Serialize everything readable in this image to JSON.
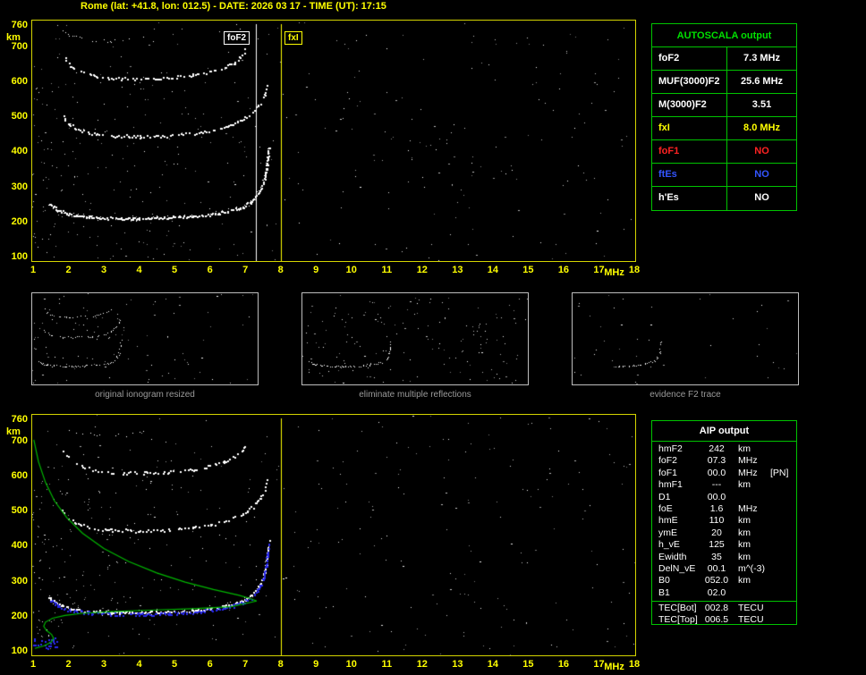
{
  "header": {
    "title": "Rome (lat: +41.8, lon: 012.5) - DATE: 2026 03 17 - TIME (UT): 17:15"
  },
  "autoscala_table": {
    "title": "AUTOSCALA output",
    "rows": [
      {
        "param": "foF2",
        "value": "7.3 MHz",
        "color": "#ffffff"
      },
      {
        "param": "MUF(3000)F2",
        "value": "25.6 MHz",
        "color": "#ffffff"
      },
      {
        "param": "M(3000)F2",
        "value": "3.51",
        "color": "#ffffff"
      },
      {
        "param": "fxI",
        "value": "8.0 MHz",
        "color": "#ffff00"
      },
      {
        "param": "foF1",
        "value": "NO",
        "color": "#ff2222"
      },
      {
        "param": "ftEs",
        "value": "NO",
        "color": "#3355ff"
      },
      {
        "param": "h'Es",
        "value": "NO",
        "color": "#ffffff"
      }
    ]
  },
  "aip_table": {
    "title": "AIP output",
    "rows": [
      {
        "param": "hmF2",
        "value": "242",
        "unit": "km",
        "note": ""
      },
      {
        "param": "foF2",
        "value": "07.3",
        "unit": "MHz",
        "note": ""
      },
      {
        "param": "foF1",
        "value": "00.0",
        "unit": "MHz",
        "note": "[PN]"
      },
      {
        "param": "hmF1",
        "value": "---",
        "unit": "km",
        "note": ""
      },
      {
        "param": "D1",
        "value": "00.0",
        "unit": "",
        "note": ""
      },
      {
        "param": "foE",
        "value": "1.6",
        "unit": "MHz",
        "note": ""
      },
      {
        "param": "hmE",
        "value": "110",
        "unit": "km",
        "note": ""
      },
      {
        "param": "ymE",
        "value": "20",
        "unit": "km",
        "note": ""
      },
      {
        "param": "h_vE",
        "value": "125",
        "unit": "km",
        "note": ""
      },
      {
        "param": "Ewidth",
        "value": "35",
        "unit": "km",
        "note": ""
      },
      {
        "param": "DelN_vE",
        "value": "00.1",
        "unit": "m^(-3)",
        "note": ""
      },
      {
        "param": "B0",
        "value": "052.0",
        "unit": "km",
        "note": ""
      },
      {
        "param": "B1",
        "value": "02.0",
        "unit": "",
        "note": ""
      }
    ],
    "tec_rows": [
      {
        "param": "TEC[Bot]",
        "value": "002.8",
        "unit": "TECU"
      },
      {
        "param": "TEC[Top]",
        "value": "006.5",
        "unit": "TECU"
      }
    ]
  },
  "thumbnails": [
    {
      "caption": "original ionogram resized"
    },
    {
      "caption": "eliminate multiple reflections"
    },
    {
      "caption": "evidence F2 trace"
    }
  ],
  "chart_data": {
    "type": "scatter",
    "title": "Ionogram: virtual height (km) vs sounding frequency (MHz)",
    "x_axis": {
      "label": "MHz",
      "min": 1,
      "max": 18,
      "ticks": [
        1,
        2,
        3,
        4,
        5,
        6,
        7,
        8,
        9,
        10,
        11,
        12,
        13,
        14,
        15,
        16,
        17,
        18
      ]
    },
    "y_axis": {
      "label": "km",
      "min": 100,
      "max": 760,
      "ticks": [
        760,
        700,
        600,
        500,
        400,
        300,
        200,
        100
      ]
    },
    "markers": [
      {
        "name": "foF2",
        "freq_mhz": 7.3,
        "color": "#ffffff"
      },
      {
        "name": "fxI",
        "freq_mhz": 8.0,
        "color": "#ffff00"
      }
    ],
    "traces": {
      "echo1": [
        [
          1.45,
          252
        ],
        [
          1.7,
          233
        ],
        [
          2.0,
          222
        ],
        [
          2.5,
          215
        ],
        [
          3.2,
          211
        ],
        [
          4.0,
          210
        ],
        [
          4.8,
          212
        ],
        [
          5.5,
          216
        ],
        [
          6.0,
          221
        ],
        [
          6.5,
          230
        ],
        [
          6.9,
          242
        ],
        [
          7.15,
          257
        ],
        [
          7.35,
          280
        ],
        [
          7.5,
          310
        ],
        [
          7.58,
          348
        ],
        [
          7.63,
          385
        ],
        [
          7.66,
          412
        ]
      ],
      "echo2": [
        [
          1.8,
          505
        ],
        [
          2.0,
          478
        ],
        [
          2.3,
          461
        ],
        [
          2.7,
          451
        ],
        [
          3.2,
          446
        ],
        [
          4.0,
          443
        ],
        [
          4.8,
          446
        ],
        [
          5.5,
          452
        ],
        [
          6.0,
          460
        ],
        [
          6.5,
          472
        ],
        [
          6.9,
          490
        ],
        [
          7.2,
          512
        ],
        [
          7.4,
          538
        ],
        [
          7.55,
          565
        ],
        [
          7.62,
          588
        ]
      ],
      "echo3": [
        [
          1.85,
          672
        ],
        [
          2.05,
          645
        ],
        [
          2.35,
          626
        ],
        [
          2.8,
          614
        ],
        [
          3.5,
          608
        ],
        [
          4.2,
          608
        ],
        [
          4.9,
          612
        ],
        [
          5.5,
          618
        ],
        [
          6.0,
          628
        ],
        [
          6.4,
          640
        ],
        [
          6.7,
          655
        ],
        [
          6.9,
          674
        ],
        [
          7.0,
          692
        ]
      ],
      "echo4": [
        [
          1.75,
          750
        ],
        [
          2.0,
          734
        ],
        [
          2.3,
          723
        ],
        [
          2.7,
          716
        ],
        [
          3.2,
          714
        ],
        [
          3.7,
          717
        ],
        [
          4.1,
          723
        ]
      ],
      "f2_evidence": [
        [
          4.2,
          210
        ],
        [
          4.8,
          212
        ],
        [
          5.5,
          216
        ],
        [
          6.0,
          221
        ],
        [
          6.5,
          230
        ],
        [
          6.9,
          242
        ],
        [
          7.15,
          257
        ],
        [
          7.35,
          280
        ],
        [
          7.5,
          310
        ],
        [
          7.58,
          348
        ],
        [
          7.63,
          385
        ],
        [
          7.66,
          412
        ]
      ]
    },
    "profile_green": {
      "color": "#00b800",
      "topside": [
        [
          1.02,
          702
        ],
        [
          1.15,
          640
        ],
        [
          1.35,
          580
        ],
        [
          1.6,
          528
        ],
        [
          1.95,
          480
        ],
        [
          2.4,
          435
        ],
        [
          3.0,
          392
        ],
        [
          3.7,
          355
        ],
        [
          4.5,
          322
        ],
        [
          5.3,
          296
        ],
        [
          6.1,
          275
        ],
        [
          6.8,
          259
        ],
        [
          7.15,
          249
        ],
        [
          7.32,
          242
        ]
      ],
      "bottomside": [
        [
          7.32,
          242
        ],
        [
          6.6,
          226
        ],
        [
          5.5,
          220
        ],
        [
          4.3,
          216
        ],
        [
          3.2,
          212
        ],
        [
          2.4,
          207
        ],
        [
          1.9,
          201
        ],
        [
          1.55,
          193
        ],
        [
          1.35,
          182
        ],
        [
          1.3,
          170
        ],
        [
          1.38,
          158
        ],
        [
          1.52,
          147
        ],
        [
          1.58,
          136
        ],
        [
          1.5,
          124
        ],
        [
          1.3,
          114
        ],
        [
          1.05,
          107
        ]
      ]
    },
    "restored_trace_blue": {
      "color": "#2a2aee"
    },
    "noise_seed": 20260317
  }
}
